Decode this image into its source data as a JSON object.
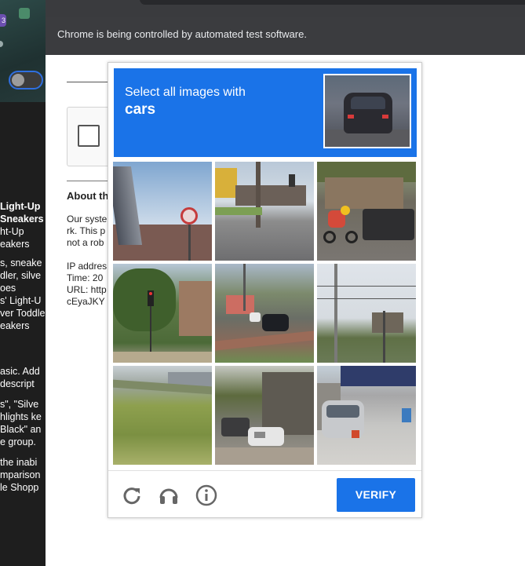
{
  "browser": {
    "infobar_text": "Chrome is being controlled by automated test software."
  },
  "left_panel": {
    "badge": "3",
    "text_lines": [
      "Light-Up",
      "Sneakers",
      "ht-Up",
      "eakers",
      "",
      "s, sneake",
      "dler, silve",
      "oes",
      "s' Light-U",
      "ver Toddle",
      "eakers",
      "",
      "",
      "",
      "asic. Add",
      " descript",
      "",
      "s\", \"Silve",
      "hlights ke",
      "Black\" an",
      "e group.",
      "",
      " the inabi",
      "mparison",
      "le Shopp"
    ]
  },
  "page": {
    "about_title": "About th",
    "lines_a": [
      "Our syste",
      "rk. This p",
      "not a rob"
    ],
    "lines_b": [
      "IP addres",
      "Time: 20",
      "URL: http",
      "cEyaJKY"
    ]
  },
  "captcha": {
    "instruction_line1": "Select all images with",
    "instruction_line2": "cars",
    "tiles": [
      {
        "index": 1,
        "scene": "sky-with-round-sign"
      },
      {
        "index": 2,
        "scene": "street-intersection"
      },
      {
        "index": 3,
        "scene": "motorcycle-and-truck"
      },
      {
        "index": 4,
        "scene": "traffic-light-trees"
      },
      {
        "index": 5,
        "scene": "road-with-cars"
      },
      {
        "index": 6,
        "scene": "power-lines-houses"
      },
      {
        "index": 7,
        "scene": "grass-hill"
      },
      {
        "index": 8,
        "scene": "parked-cars-building"
      },
      {
        "index": 9,
        "scene": "silver-car-driveway"
      }
    ],
    "verify_label": "VERIFY",
    "icons": [
      "reload-icon",
      "audio-icon",
      "info-icon"
    ]
  },
  "colors": {
    "accent": "#1a73e8",
    "infobar_bg": "#3b3c3f",
    "panel_bg": "#1e1e1e"
  }
}
